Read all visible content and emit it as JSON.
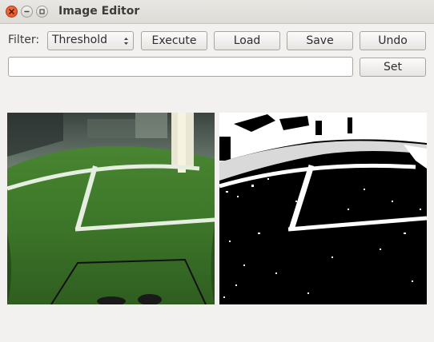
{
  "window": {
    "title": "Image Editor"
  },
  "toolbar": {
    "filter_label": "Filter:",
    "filter_value": "Threshold",
    "execute_label": "Execute",
    "load_label": "Load",
    "save_label": "Save",
    "undo_label": "Undo",
    "set_label": "Set",
    "param_value": ""
  },
  "images": {
    "original": "soccer-field-camera-view",
    "processed": "thresholded-binary-view"
  }
}
